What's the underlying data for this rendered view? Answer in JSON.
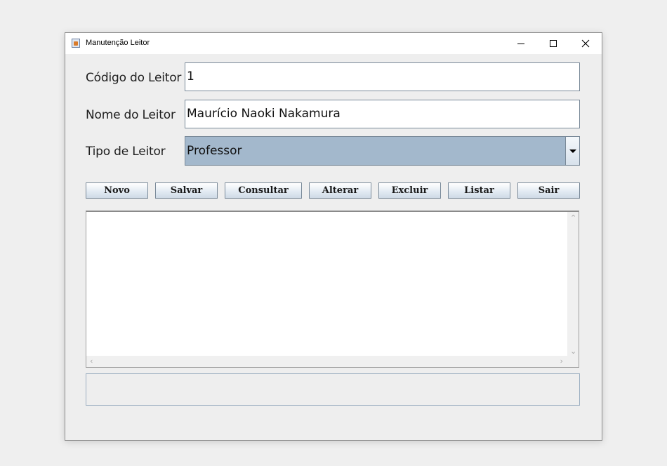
{
  "window": {
    "title": "Manutenção Leitor"
  },
  "form": {
    "codigo": {
      "label": "Código do Leitor",
      "value": "1"
    },
    "nome": {
      "label": "Nome do Leitor",
      "value": "Maurício Naoki Nakamura"
    },
    "tipo": {
      "label": "Tipo de Leitor",
      "selected": "Professor"
    }
  },
  "buttons": {
    "novo": "Novo",
    "salvar": "Salvar",
    "consultar": "Consultar",
    "alterar": "Alterar",
    "excluir": "Excluir",
    "listar": "Listar",
    "sair": "Sair"
  },
  "output": {
    "text": ""
  },
  "status": {
    "text": ""
  },
  "colors": {
    "combo_selection": "#a3b8cc",
    "button_top": "#ffffff",
    "button_bottom": "#cfdae6"
  },
  "icons": {
    "app": "java-app-icon",
    "minimize": "minimize-icon",
    "maximize": "maximize-icon",
    "close": "close-icon"
  }
}
